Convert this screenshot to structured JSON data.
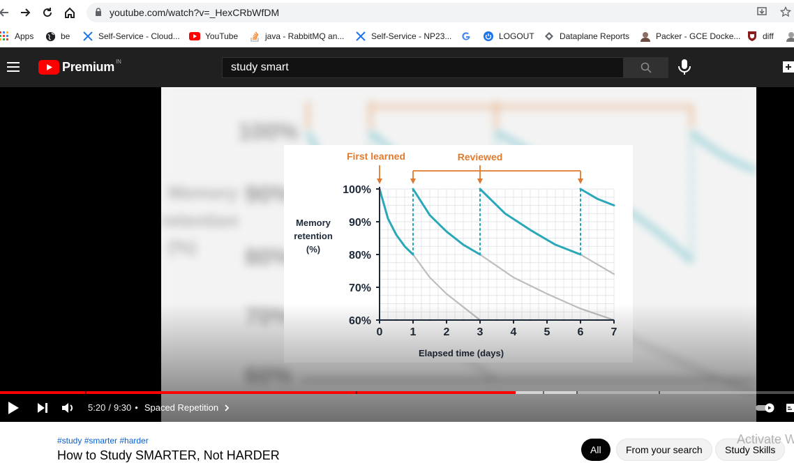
{
  "browser": {
    "url": "youtube.com/watch?v=_HexCRbWfDM",
    "bookmarks": [
      {
        "label": "Apps",
        "icon": "apps-grid-icon"
      },
      {
        "label": "be",
        "icon": "globe-icon"
      },
      {
        "label": "Self-Service - Cloud...",
        "icon": "x-logo-icon"
      },
      {
        "label": "YouTube",
        "icon": "youtube-icon"
      },
      {
        "label": "java - RabbitMQ an...",
        "icon": "stackoverflow-icon"
      },
      {
        "label": "Self-Service - NP23...",
        "icon": "x-logo-icon"
      },
      {
        "label": "",
        "icon": "google-icon"
      },
      {
        "label": "LOGOUT",
        "icon": "power-icon"
      },
      {
        "label": "Dataplane Reports",
        "icon": "diamond-icon"
      },
      {
        "label": "Packer - GCE Docke...",
        "icon": "avatar-icon"
      },
      {
        "label": "diff",
        "icon": "shield-icon"
      }
    ]
  },
  "youtube": {
    "brand": "Premium",
    "region": "IN",
    "search_query": "study smart"
  },
  "player": {
    "time_current": "5:20",
    "time_total": "9:30",
    "chapter": "Spaced Repetition",
    "progress_played": 0.649,
    "progress_buffered": 0.726
  },
  "chart_data": {
    "type": "line",
    "title": "",
    "xlabel": "Elapsed time (days)",
    "ylabel": "Memory retention (%)",
    "ylabel_lines": [
      "Memory",
      "retention",
      "(%)"
    ],
    "xlim": [
      0,
      7
    ],
    "ylim": [
      60,
      100
    ],
    "x_ticks": [
      0,
      1,
      2,
      3,
      4,
      5,
      6,
      7
    ],
    "y_ticks": [
      "100%",
      "90%",
      "80%",
      "70%",
      "60%"
    ],
    "y_tick_values": [
      100,
      90,
      80,
      70,
      60
    ],
    "grid": true,
    "annotations": [
      {
        "text": "First learned",
        "x": 0
      },
      {
        "text": "Reviewed",
        "x": [
          1,
          3,
          6
        ]
      }
    ],
    "series": [
      {
        "role": "retention-with-review",
        "color": "#2aa8b8",
        "segments": [
          {
            "x": [
              0,
              0.25,
              0.5,
              0.75,
              1
            ],
            "y": [
              100,
              91,
              86,
              82.5,
              80
            ]
          },
          {
            "x": [
              1,
              1.5,
              2,
              2.5,
              3
            ],
            "y": [
              100,
              92,
              87,
              83,
              80
            ]
          },
          {
            "x": [
              3,
              3.75,
              4.5,
              5.25,
              6
            ],
            "y": [
              100,
              92.5,
              87.5,
              83,
              80
            ]
          },
          {
            "x": [
              6,
              6.5,
              7
            ],
            "y": [
              100,
              97,
              95
            ]
          }
        ]
      },
      {
        "role": "forgetting-without-review",
        "color": "#bdbdbd",
        "segments": [
          {
            "x": [
              1,
              1.5,
              2,
              2.5,
              3
            ],
            "y": [
              80,
              73,
              68,
              64,
              60
            ]
          },
          {
            "x": [
              3,
              4,
              5,
              6,
              7
            ],
            "y": [
              80,
              73,
              68,
              63.5,
              60
            ]
          },
          {
            "x": [
              6,
              6.5,
              7
            ],
            "y": [
              80,
              77,
              74
            ]
          }
        ]
      }
    ],
    "colors": {
      "annotation": "#e07a2e",
      "axis": "#1e2a3a",
      "grid": "#d9dde2"
    }
  },
  "below": {
    "hashtags": "#study #smarter #harder",
    "title": "How to Study SMARTER, Not HARDER",
    "chips": [
      "All",
      "From your search",
      "Study Skills"
    ],
    "watermark": "Activate W"
  }
}
